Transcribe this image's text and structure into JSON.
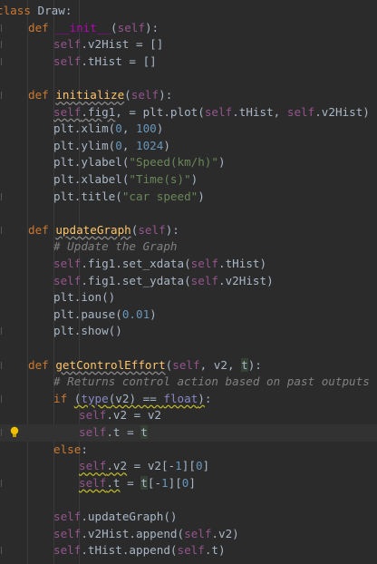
{
  "lines": [
    "class Draw:",
    "    def __init__(self):",
    "        self.v2Hist = []",
    "        self.tHist = []",
    "",
    "    def initialize(self):",
    "        self.fig1, = plt.plot(self.tHist, self.v2Hist)",
    "        plt.xlim(0, 100)",
    "        plt.ylim(0, 1024)",
    "        plt.ylabel(\"Speed(km/h)\")",
    "        plt.xlabel(\"Time(s)\")",
    "        plt.title(\"car speed\")",
    "",
    "    def updateGraph(self):",
    "        # Update the Graph",
    "        self.fig1.set_xdata(self.tHist)",
    "        self.fig1.set_ydata(self.v2Hist)",
    "        plt.ion()",
    "        plt.pause(0.01)",
    "        plt.show()",
    "",
    "    def getControlEffort(self, v2, t):",
    "        # Returns control action based on past outputs",
    "        if (type(v2) == float):",
    "            self.v2 = v2",
    "            self.t = t",
    "        else:",
    "            self.v2 = v2[-1][0]",
    "            self.t = t[-1][0]",
    "",
    "        self.updateGraph()",
    "        self.v2Hist.append(self.v2)",
    "        self.tHist.append(self.t)"
  ],
  "tokens": {
    "kw_class": "class",
    "class_name": " Draw:",
    "def": "def",
    "init": "__init__",
    "self": "self",
    "initialize": "initialize",
    "updateGraph": "updateGraph",
    "getControlEffort": "getControlEffort",
    "comment1": "# Update the Graph",
    "comment2": "# Returns control action based on past outputs",
    "if": "if",
    "else": "else",
    "type": "type",
    "float": "float",
    "n0": "0",
    "n100": "100",
    "n1024": "1024",
    "n001": "0.01",
    "n1": "1",
    "s_speed": "\"Speed(km/h)\"",
    "s_time": "\"Time(s)\"",
    "s_title": "\"car speed\""
  },
  "editor": {
    "current_line": 26,
    "bulb": "lightbulb-icon"
  }
}
